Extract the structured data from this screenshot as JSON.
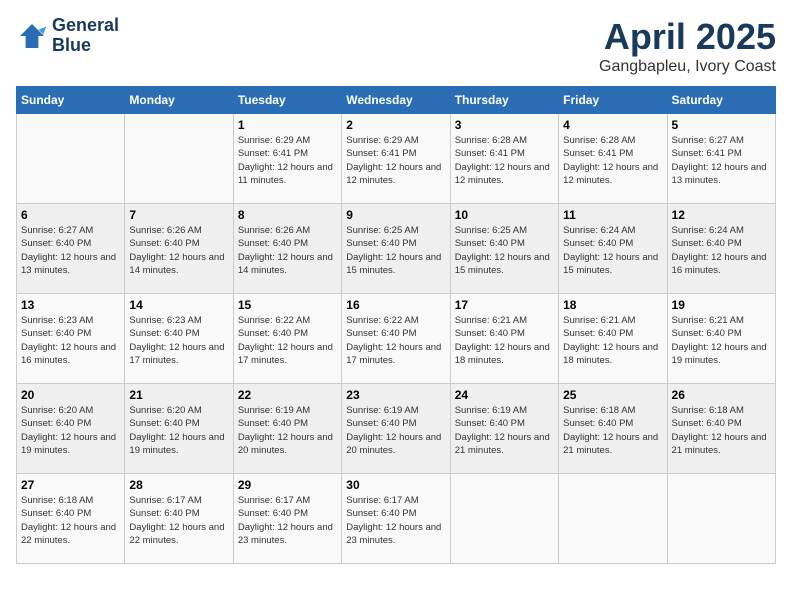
{
  "logo": {
    "line1": "General",
    "line2": "Blue"
  },
  "title": "April 2025",
  "location": "Gangbapleu, Ivory Coast",
  "weekdays": [
    "Sunday",
    "Monday",
    "Tuesday",
    "Wednesday",
    "Thursday",
    "Friday",
    "Saturday"
  ],
  "weeks": [
    [
      {
        "day": "",
        "info": ""
      },
      {
        "day": "",
        "info": ""
      },
      {
        "day": "1",
        "info": "Sunrise: 6:29 AM\nSunset: 6:41 PM\nDaylight: 12 hours and 11 minutes."
      },
      {
        "day": "2",
        "info": "Sunrise: 6:29 AM\nSunset: 6:41 PM\nDaylight: 12 hours and 12 minutes."
      },
      {
        "day": "3",
        "info": "Sunrise: 6:28 AM\nSunset: 6:41 PM\nDaylight: 12 hours and 12 minutes."
      },
      {
        "day": "4",
        "info": "Sunrise: 6:28 AM\nSunset: 6:41 PM\nDaylight: 12 hours and 12 minutes."
      },
      {
        "day": "5",
        "info": "Sunrise: 6:27 AM\nSunset: 6:41 PM\nDaylight: 12 hours and 13 minutes."
      }
    ],
    [
      {
        "day": "6",
        "info": "Sunrise: 6:27 AM\nSunset: 6:40 PM\nDaylight: 12 hours and 13 minutes."
      },
      {
        "day": "7",
        "info": "Sunrise: 6:26 AM\nSunset: 6:40 PM\nDaylight: 12 hours and 14 minutes."
      },
      {
        "day": "8",
        "info": "Sunrise: 6:26 AM\nSunset: 6:40 PM\nDaylight: 12 hours and 14 minutes."
      },
      {
        "day": "9",
        "info": "Sunrise: 6:25 AM\nSunset: 6:40 PM\nDaylight: 12 hours and 15 minutes."
      },
      {
        "day": "10",
        "info": "Sunrise: 6:25 AM\nSunset: 6:40 PM\nDaylight: 12 hours and 15 minutes."
      },
      {
        "day": "11",
        "info": "Sunrise: 6:24 AM\nSunset: 6:40 PM\nDaylight: 12 hours and 15 minutes."
      },
      {
        "day": "12",
        "info": "Sunrise: 6:24 AM\nSunset: 6:40 PM\nDaylight: 12 hours and 16 minutes."
      }
    ],
    [
      {
        "day": "13",
        "info": "Sunrise: 6:23 AM\nSunset: 6:40 PM\nDaylight: 12 hours and 16 minutes."
      },
      {
        "day": "14",
        "info": "Sunrise: 6:23 AM\nSunset: 6:40 PM\nDaylight: 12 hours and 17 minutes."
      },
      {
        "day": "15",
        "info": "Sunrise: 6:22 AM\nSunset: 6:40 PM\nDaylight: 12 hours and 17 minutes."
      },
      {
        "day": "16",
        "info": "Sunrise: 6:22 AM\nSunset: 6:40 PM\nDaylight: 12 hours and 17 minutes."
      },
      {
        "day": "17",
        "info": "Sunrise: 6:21 AM\nSunset: 6:40 PM\nDaylight: 12 hours and 18 minutes."
      },
      {
        "day": "18",
        "info": "Sunrise: 6:21 AM\nSunset: 6:40 PM\nDaylight: 12 hours and 18 minutes."
      },
      {
        "day": "19",
        "info": "Sunrise: 6:21 AM\nSunset: 6:40 PM\nDaylight: 12 hours and 19 minutes."
      }
    ],
    [
      {
        "day": "20",
        "info": "Sunrise: 6:20 AM\nSunset: 6:40 PM\nDaylight: 12 hours and 19 minutes."
      },
      {
        "day": "21",
        "info": "Sunrise: 6:20 AM\nSunset: 6:40 PM\nDaylight: 12 hours and 19 minutes."
      },
      {
        "day": "22",
        "info": "Sunrise: 6:19 AM\nSunset: 6:40 PM\nDaylight: 12 hours and 20 minutes."
      },
      {
        "day": "23",
        "info": "Sunrise: 6:19 AM\nSunset: 6:40 PM\nDaylight: 12 hours and 20 minutes."
      },
      {
        "day": "24",
        "info": "Sunrise: 6:19 AM\nSunset: 6:40 PM\nDaylight: 12 hours and 21 minutes."
      },
      {
        "day": "25",
        "info": "Sunrise: 6:18 AM\nSunset: 6:40 PM\nDaylight: 12 hours and 21 minutes."
      },
      {
        "day": "26",
        "info": "Sunrise: 6:18 AM\nSunset: 6:40 PM\nDaylight: 12 hours and 21 minutes."
      }
    ],
    [
      {
        "day": "27",
        "info": "Sunrise: 6:18 AM\nSunset: 6:40 PM\nDaylight: 12 hours and 22 minutes."
      },
      {
        "day": "28",
        "info": "Sunrise: 6:17 AM\nSunset: 6:40 PM\nDaylight: 12 hours and 22 minutes."
      },
      {
        "day": "29",
        "info": "Sunrise: 6:17 AM\nSunset: 6:40 PM\nDaylight: 12 hours and 23 minutes."
      },
      {
        "day": "30",
        "info": "Sunrise: 6:17 AM\nSunset: 6:40 PM\nDaylight: 12 hours and 23 minutes."
      },
      {
        "day": "",
        "info": ""
      },
      {
        "day": "",
        "info": ""
      },
      {
        "day": "",
        "info": ""
      }
    ]
  ]
}
